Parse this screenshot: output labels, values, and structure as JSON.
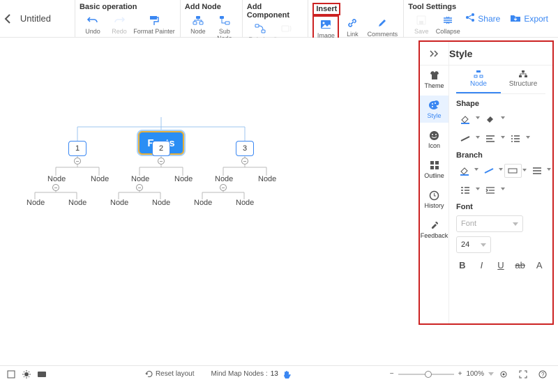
{
  "title": "Untitled",
  "toolbar": {
    "groups": {
      "basic": {
        "label": "Basic operation",
        "undo": "Undo",
        "redo": "Redo",
        "format_painter": "Format Painter"
      },
      "add_node": {
        "label": "Add Node",
        "node": "Node",
        "sub_node": "Sub Node"
      },
      "add_component": {
        "label": "Add Component",
        "relation": "Relation",
        "summary": "Summary"
      },
      "insert": {
        "label": "Insert",
        "image": "Image",
        "link": "Link",
        "comments": "Comments"
      },
      "tool": {
        "label": "Tool Settings",
        "save": "Save",
        "collapse": "Collapse"
      }
    },
    "share": "Share",
    "export": "Export"
  },
  "map": {
    "root": "Facts",
    "child1": "1",
    "child2": "2",
    "child3": "3",
    "node_label": "Node"
  },
  "panel": {
    "title": "Style",
    "tabs": {
      "theme": "Theme",
      "style": "Style",
      "icon": "Icon",
      "outline": "Outline",
      "history": "History",
      "feedback": "Feedback"
    },
    "subtabs": {
      "node": "Node",
      "structure": "Structure"
    },
    "sections": {
      "shape": "Shape",
      "branch": "Branch",
      "font": "Font"
    },
    "font_placeholder": "Font",
    "font_size": "24",
    "abc": "ab"
  },
  "bottom": {
    "reset_layout": "Reset layout",
    "mind_map_nodes_label": "Mind Map Nodes :",
    "mind_map_nodes": "13",
    "zoom": "100%"
  }
}
